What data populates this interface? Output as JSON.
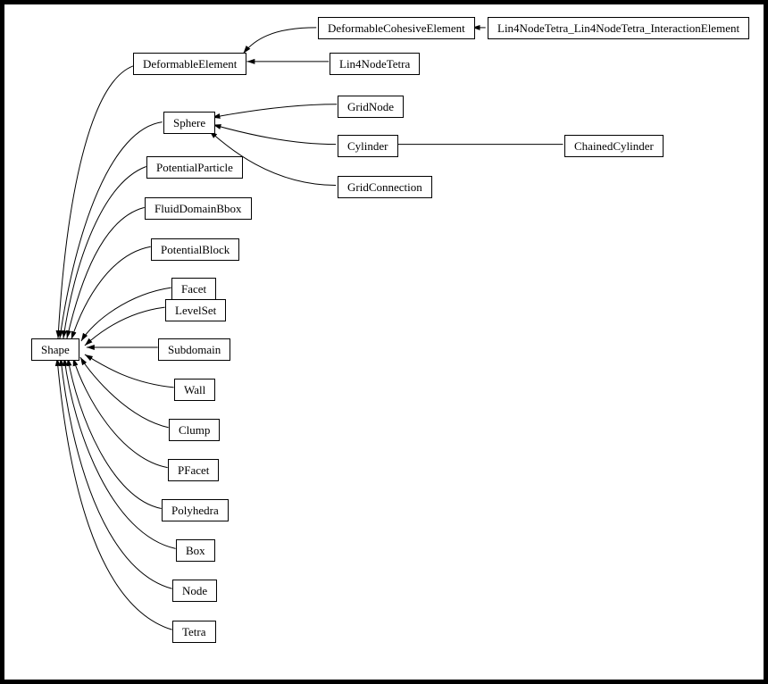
{
  "diagram": {
    "root": "Shape",
    "nodes": {
      "shape": "Shape",
      "deformableElement": "DeformableElement",
      "deformableCohesiveElement": "DeformableCohesiveElement",
      "lin4nodeTetraInteraction": "Lin4NodeTetra_Lin4NodeTetra_InteractionElement",
      "lin4nodeTetra": "Lin4NodeTetra",
      "sphere": "Sphere",
      "gridNode": "GridNode",
      "cylinder": "Cylinder",
      "gridConnection": "GridConnection",
      "chainedCylinder": "ChainedCylinder",
      "potentialParticle": "PotentialParticle",
      "fluidDomainBbox": "FluidDomainBbox",
      "potentialBlock": "PotentialBlock",
      "facet": "Facet",
      "levelSet": "LevelSet",
      "subdomain": "Subdomain",
      "wall": "Wall",
      "clump": "Clump",
      "pfacet": "PFacet",
      "polyhedra": "Polyhedra",
      "box": "Box",
      "node": "Node",
      "tetra": "Tetra"
    }
  }
}
